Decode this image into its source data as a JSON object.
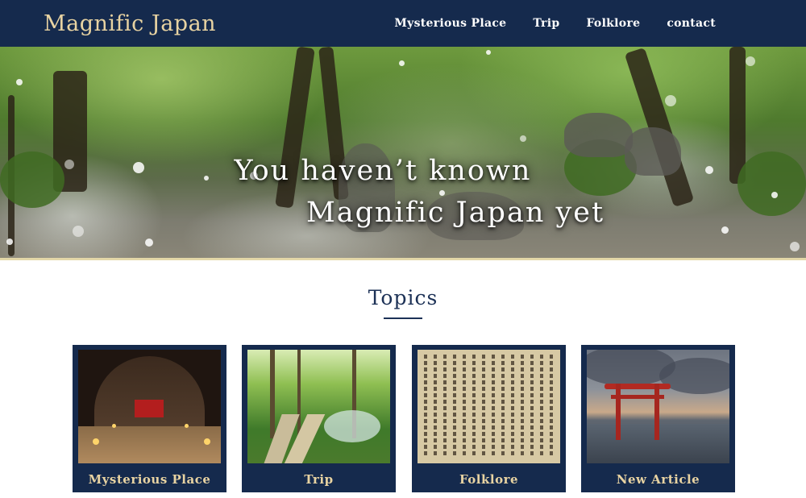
{
  "header": {
    "logo": "Magnific Japan",
    "nav": [
      "Mysterious Place",
      "Trip",
      "Folklore",
      "contact"
    ]
  },
  "hero": {
    "line1": "You haven’t known",
    "line2": "Magnific Japan yet"
  },
  "topics": {
    "title": "Topics",
    "cards": [
      {
        "label": "Mysterious Place",
        "image": "tunnel-shrine-photo"
      },
      {
        "label": "Trip",
        "image": "forest-path-photo"
      },
      {
        "label": "Folklore",
        "image": "old-manuscript-photo"
      },
      {
        "label": "New Article",
        "image": "torii-gate-sunset-photo"
      }
    ]
  },
  "colors": {
    "navy": "#152a4d",
    "gold": "#e8d3a2",
    "white": "#ffffff"
  }
}
